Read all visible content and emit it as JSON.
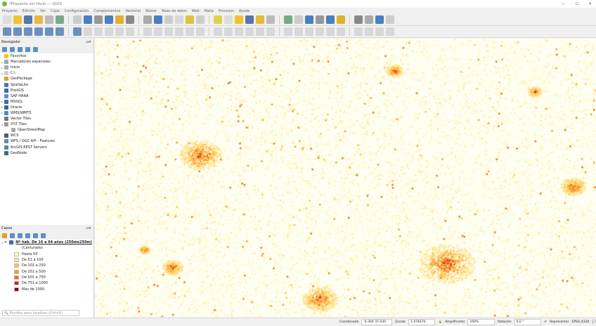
{
  "window": {
    "title": "*Proyecto sin título — QGIS",
    "controls": [
      "—",
      "☐",
      "✕"
    ]
  },
  "menu": [
    "Proyecto",
    "Edición",
    "Ver",
    "Capa",
    "Configuración",
    "Complementos",
    "Vectorial",
    "Ráster",
    "Base de datos",
    "Web",
    "Malla",
    "Procesos",
    "Ayuda"
  ],
  "browser": {
    "title": "Navegador",
    "items": [
      {
        "label": "Favoritos",
        "icon": "star-icon",
        "color": "#f5c518",
        "expand": ""
      },
      {
        "label": "Marcadores espaciales",
        "icon": "bookmark-icon",
        "color": "#9aa",
        "expand": "▸"
      },
      {
        "label": "Inicio",
        "icon": "home-folder-icon",
        "color": "#aab",
        "expand": "▸"
      },
      {
        "label": "C:\\",
        "icon": "drive-icon",
        "color": "#ccc",
        "expand": "▸"
      },
      {
        "label": "GeoPackage",
        "icon": "geopackage-icon",
        "color": "#d9a32b",
        "expand": ""
      },
      {
        "label": "SpatiaLite",
        "icon": "spatialite-icon",
        "color": "#4a78b5",
        "expand": ""
      },
      {
        "label": "PostGIS",
        "icon": "postgis-icon",
        "color": "#3a6fa8",
        "expand": ""
      },
      {
        "label": "SAP HANA",
        "icon": "hana-icon",
        "color": "#6a8fc0",
        "expand": ""
      },
      {
        "label": "MSSQL",
        "icon": "mssql-icon",
        "color": "#3b6cb0",
        "expand": "▸"
      },
      {
        "label": "Oracle",
        "icon": "oracle-icon",
        "color": "#2d6aa3",
        "expand": "▸"
      },
      {
        "label": "WMS/WMTS",
        "icon": "wms-icon",
        "color": "#4a88c0",
        "expand": "▸"
      },
      {
        "label": "Vector Tiles",
        "icon": "vector-tiles-icon",
        "color": "#777",
        "expand": ""
      },
      {
        "label": "XYZ Tiles",
        "icon": "xyz-tiles-icon",
        "color": "#999",
        "expand": "▾"
      },
      {
        "label": "OpenStreetMap",
        "icon": "tile-icon",
        "color": "#aaa",
        "expand": "",
        "child": true
      },
      {
        "label": "WCS",
        "icon": "wcs-icon",
        "color": "#557",
        "expand": ""
      },
      {
        "label": "WFS / OGC API - Features",
        "icon": "wfs-icon",
        "color": "#68a",
        "expand": ""
      },
      {
        "label": "ArcGIS REST Servers",
        "icon": "arcgis-icon",
        "color": "#58a",
        "expand": ""
      },
      {
        "label": "GeoNode",
        "icon": "geonode-icon",
        "color": "#468",
        "expand": ""
      }
    ]
  },
  "layers": {
    "title": "Capas",
    "layer_name": "Nº hab. De 16 a 64 años (250mx250m)",
    "style": "(Centurado)",
    "legend": [
      {
        "label": "Hasta 50",
        "color": "#fff7bc"
      },
      {
        "label": "De 51 a 100",
        "color": "#fee391"
      },
      {
        "label": "De 101 a 250",
        "color": "#fec44f"
      },
      {
        "label": "De 251 a 500",
        "color": "#fe9929"
      },
      {
        "label": "De 501 a 750",
        "color": "#ec7014"
      },
      {
        "label": "De 751 a 1000",
        "color": "#e31a1c"
      },
      {
        "label": "Más de 1000",
        "color": "#8b0000"
      }
    ]
  },
  "search": {
    "placeholder": "Escriba para localizar (Ctrl+K)"
  },
  "status": {
    "coord_label": "Coordenada",
    "coord_value": "-6.304 37.030",
    "scale_label": "Escala",
    "scale_value": "1:474670",
    "magnifier_label": "Amplificador",
    "magnifier_value": "100%",
    "rotation_label": "Rotación",
    "rotation_value": "0,0 °",
    "render_label": "Representar",
    "render_checked": true,
    "crs": "EPSG:4326"
  }
}
